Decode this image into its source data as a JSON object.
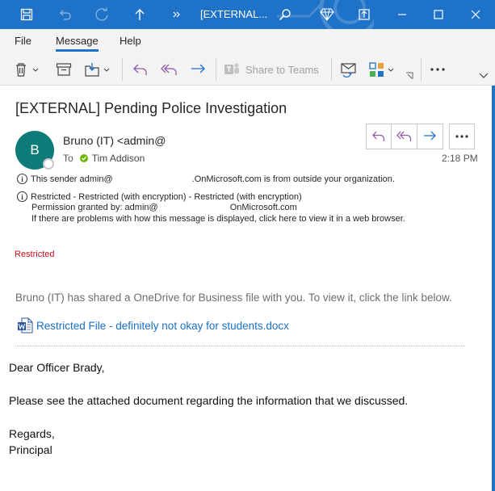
{
  "titlebar": {
    "title": "[EXTERNAL...",
    "icons": [
      "save-icon",
      "undo-icon",
      "redo-icon",
      "up-arrow-icon",
      "overflow-icon",
      "search-icon",
      "diamond-icon",
      "restore-icon",
      "minimize-icon",
      "maximize-icon",
      "close-icon"
    ]
  },
  "tabs": [
    {
      "label": "File"
    },
    {
      "label": "Message"
    },
    {
      "label": "Help"
    }
  ],
  "ribbon": {
    "share_label": "Share to Teams"
  },
  "message": {
    "subject": "[EXTERNAL] Pending Police Investigation",
    "avatar_initial": "B",
    "sender": "Bruno (IT) <admin@",
    "to_label": "To",
    "recipient": "Tim Addison",
    "time": "2:18 PM",
    "external_notice_prefix": "This sender admin@",
    "external_notice_suffix": ".OnMicrosoft.com is from outside your organization.",
    "restricted_notice": "Restricted - Restricted (with encryption) - Restricted (with encryption)",
    "permission_prefix": "Permission granted by: admin@",
    "permission_suffix": "OnMicrosoft.com",
    "view_notice": "If there are problems with how this message is displayed, click here to view it in a web browser.",
    "restricted_label": "Restricted",
    "shared_line": "Bruno (IT) has shared a OneDrive for Business file with you. To view it, click the link below.",
    "file_name": "Restricted File - definitely not okay for students.docx"
  },
  "body": {
    "greeting": "Dear Officer Brady,",
    "paragraph": "Please see the attached document regarding the information that we discussed.",
    "closing": "Regards,",
    "signature": "Principal"
  },
  "colors": {
    "titlebar": "#1e72c7",
    "avatar": "#0f7b78",
    "link": "#1a6fc4",
    "restricted": "#c50f1f",
    "reply_purple": "#8e5aa8"
  }
}
